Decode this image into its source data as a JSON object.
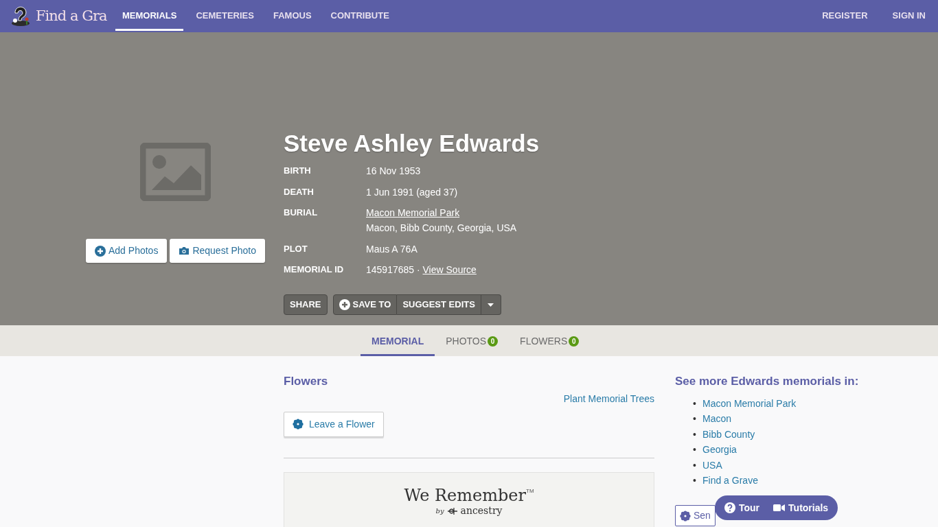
{
  "logo": {
    "text": "Find a Gra"
  },
  "nav": [
    {
      "label": "MEMORIALS",
      "selected": true
    },
    {
      "label": "CEMETERIES",
      "selected": false
    },
    {
      "label": "FAMOUS",
      "selected": false
    },
    {
      "label": "CONTRIBUTE",
      "selected": false
    }
  ],
  "account_links": [
    "REGISTER",
    "SIGN IN"
  ],
  "photo_buttons": [
    {
      "kind": "add",
      "label": "Add Photos"
    },
    {
      "kind": "request",
      "label": "Request Photo"
    }
  ],
  "memorial": {
    "name": "Steve Ashley Edwards",
    "facts": [
      {
        "label": "BIRTH",
        "lines": [
          {
            "text": "16 Nov 1953"
          }
        ]
      },
      {
        "label": "DEATH",
        "lines": [
          {
            "text": "1 Jun 1991 (aged 37)"
          }
        ]
      },
      {
        "label": "BURIAL",
        "lines": [
          {
            "text": "Macon Memorial Park",
            "link": true
          },
          {
            "text": "Macon, Bibb County, Georgia, USA"
          }
        ]
      },
      {
        "label": "PLOT",
        "lines": [
          {
            "text": "Maus A 76A"
          }
        ]
      },
      {
        "label": "MEMORIAL ID",
        "lines": [
          {
            "text": "145917685 · "
          },
          {
            "text": "View Source",
            "link": true
          }
        ]
      }
    ]
  },
  "actions": {
    "share": "SHARE",
    "save_to": "SAVE TO",
    "suggest_edits": "SUGGEST EDITS"
  },
  "tabs": [
    {
      "label": "MEMORIAL",
      "selected": true
    },
    {
      "label": "PHOTOS",
      "count": "0",
      "selected": false
    },
    {
      "label": "FLOWERS",
      "count": "0",
      "selected": false
    }
  ],
  "flowers": {
    "heading": "Flowers",
    "trees_link": "Plant Memorial Trees",
    "leave_button": "Leave a Flower"
  },
  "ad_banner": {
    "title": "We Remember",
    "trademark": "TM",
    "by": "by",
    "brand": "ancestry"
  },
  "see_more": {
    "heading": "See more **Edwards** memorials in:",
    "marker": "•",
    "links": [
      "Macon Memorial Park",
      "Macon",
      "Bibb County",
      "Georgia",
      "USA",
      "Find a Grave"
    ],
    "send_button": "Sen"
  },
  "help_bar": [
    {
      "kind": "tour",
      "label": "Tour"
    },
    {
      "kind": "tutorials",
      "label": "Tutorials"
    }
  ]
}
